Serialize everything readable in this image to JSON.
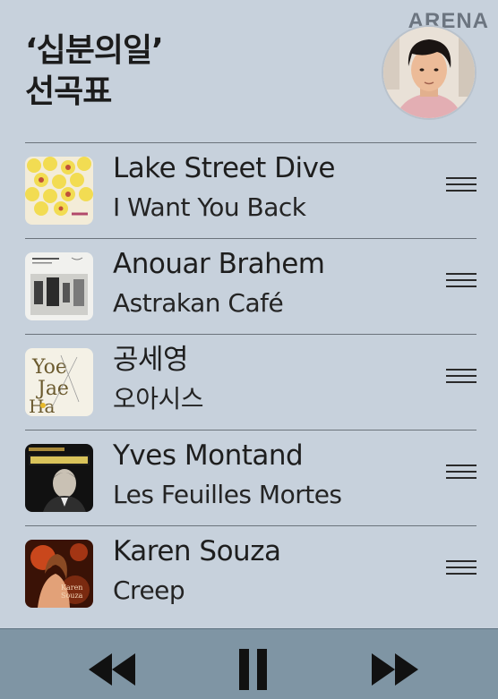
{
  "header": {
    "title_line1": "‘십분의일’",
    "title_line2": "선곡표",
    "brand": "ARENA"
  },
  "tracks": [
    {
      "artist": "Lake Street Dive",
      "song": "I Want You Back"
    },
    {
      "artist": "Anouar Brahem",
      "song": "Astrakan Café"
    },
    {
      "artist": "공세영",
      "song": "오아시스"
    },
    {
      "artist": "Yves Montand",
      "song": "Les Feuilles Mortes"
    },
    {
      "artist": "Karen Souza",
      "song": "Creep"
    }
  ],
  "player": {
    "state": "playing",
    "controls": [
      "rewind-icon",
      "pause-icon",
      "fast-forward-icon"
    ]
  },
  "colors": {
    "background": "#c7d1dc",
    "player_bar": "#7f95a4",
    "divider": "#6b737b"
  }
}
